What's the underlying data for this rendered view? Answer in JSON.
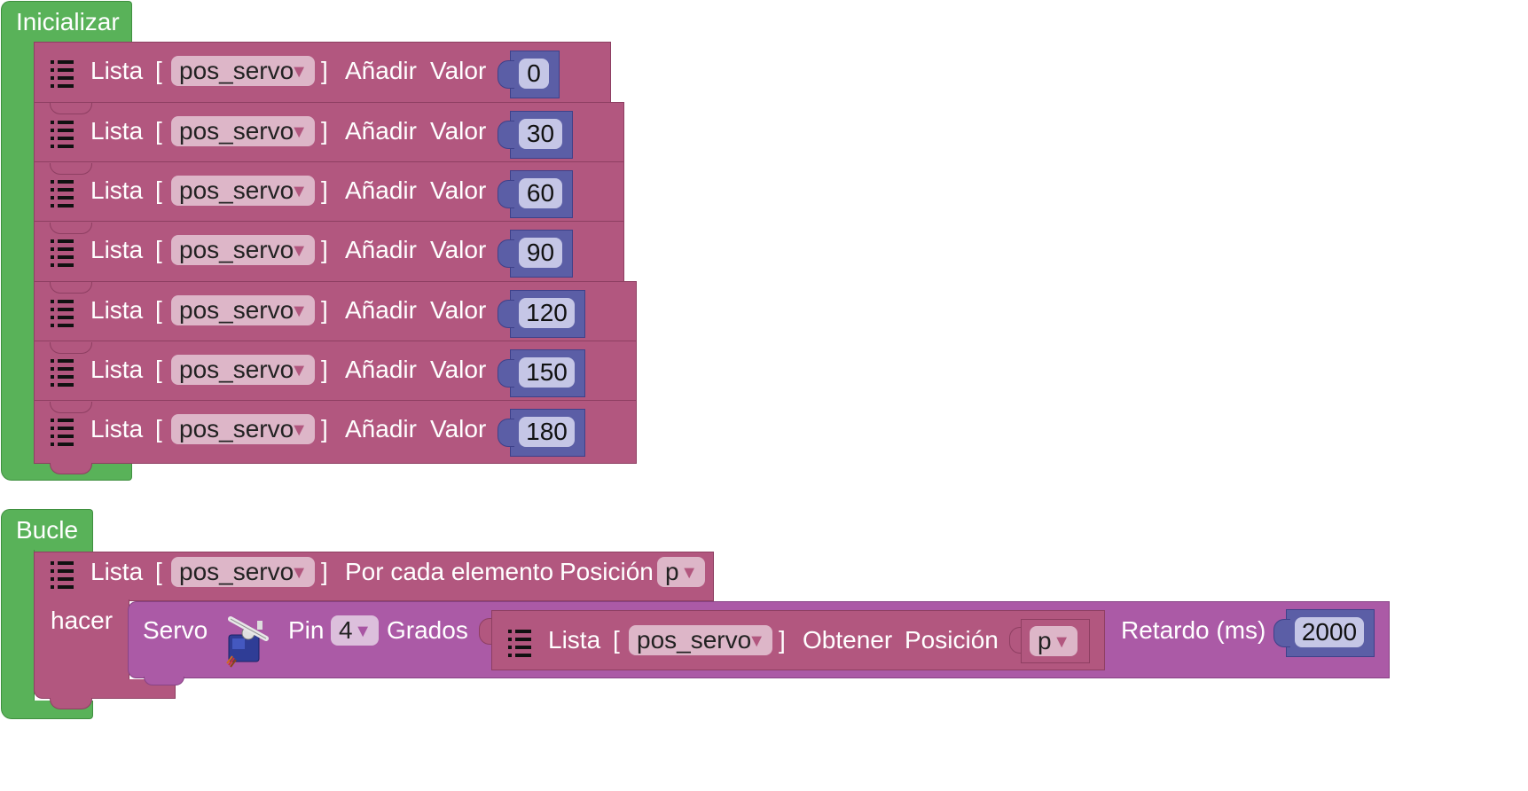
{
  "init_block": {
    "title": "Inicializar",
    "rows": [
      {
        "list_label": "Lista",
        "open_bracket": "[",
        "list_var": "pos_servo",
        "close_bracket": "]",
        "action": "Añadir",
        "value_label": "Valor",
        "value": "0"
      },
      {
        "list_label": "Lista",
        "open_bracket": "[",
        "list_var": "pos_servo",
        "close_bracket": "]",
        "action": "Añadir",
        "value_label": "Valor",
        "value": "30"
      },
      {
        "list_label": "Lista",
        "open_bracket": "[",
        "list_var": "pos_servo",
        "close_bracket": "]",
        "action": "Añadir",
        "value_label": "Valor",
        "value": "60"
      },
      {
        "list_label": "Lista",
        "open_bracket": "[",
        "list_var": "pos_servo",
        "close_bracket": "]",
        "action": "Añadir",
        "value_label": "Valor",
        "value": "90"
      },
      {
        "list_label": "Lista",
        "open_bracket": "[",
        "list_var": "pos_servo",
        "close_bracket": "]",
        "action": "Añadir",
        "value_label": "Valor",
        "value": "120"
      },
      {
        "list_label": "Lista",
        "open_bracket": "[",
        "list_var": "pos_servo",
        "close_bracket": "]",
        "action": "Añadir",
        "value_label": "Valor",
        "value": "150"
      },
      {
        "list_label": "Lista",
        "open_bracket": "[",
        "list_var": "pos_servo",
        "close_bracket": "]",
        "action": "Añadir",
        "value_label": "Valor",
        "value": "180"
      }
    ]
  },
  "loop_block": {
    "title": "Bucle",
    "foreach": {
      "list_label": "Lista",
      "open_bracket": "[",
      "list_var": "pos_servo",
      "close_bracket": "]",
      "action": "Por cada elemento",
      "position_label": "Posición",
      "position_var": "p",
      "do_label": "hacer"
    },
    "servo": {
      "label": "Servo",
      "pin_label": "Pin",
      "pin_value": "4",
      "degrees_label": "Grados",
      "get": {
        "list_label": "Lista",
        "open_bracket": "[",
        "list_var": "pos_servo",
        "close_bracket": "]",
        "action": "Obtener",
        "position_label": "Posición",
        "position_var": "p"
      },
      "delay_label": "Retardo (ms)",
      "delay_value": "2000"
    }
  },
  "icons": {
    "list": "list-icon",
    "servo": "servo-motor-icon",
    "dropdown": "dropdown-arrow-icon"
  },
  "colors": {
    "event_green": "#59b259",
    "list_rose": "#b2577f",
    "servo_purple": "#ab5aa6",
    "math_blue": "#5b5ea6"
  }
}
